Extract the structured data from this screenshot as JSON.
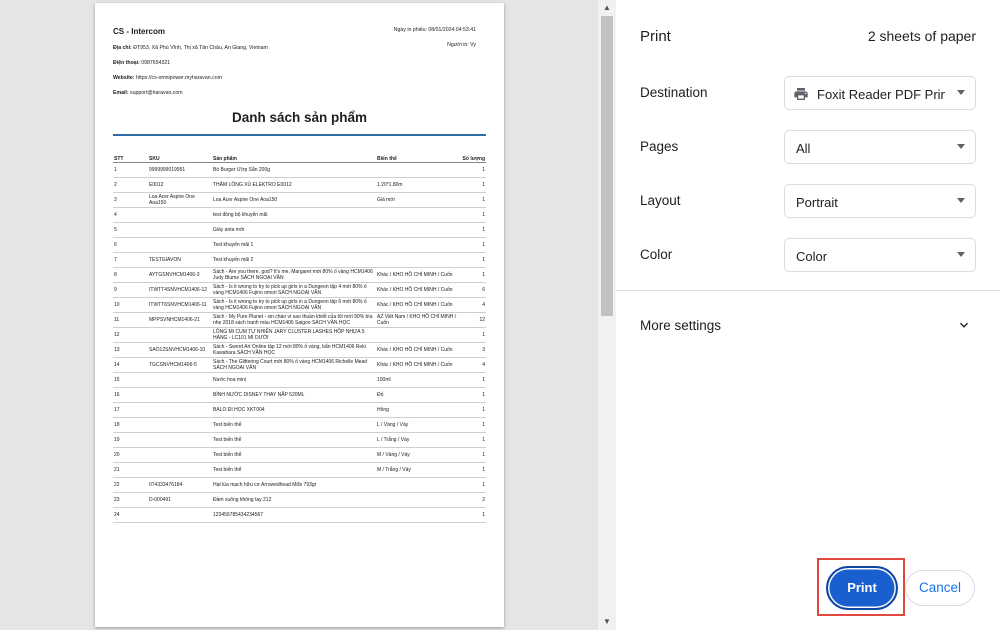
{
  "document": {
    "store_name": "CS - Intercom",
    "address_label": "Địa chỉ:",
    "address": "ĐT953, Xã Phú Vĩnh, Thị xã Tân Châu, An Giang, Vietnam",
    "phone_label": "Điện thoại:",
    "phone": "0987654321",
    "website_label": "Website:",
    "website": "https://cs-omnipower.myharavan.com",
    "email_label": "Email:",
    "email": "support@haravan.com",
    "print_date": "Ngày in phiếu: 08/01/2024 04:53:41",
    "printed_by": "Người in: Vy",
    "heading": "Danh sách sản phẩm",
    "columns": {
      "stt": "STT",
      "sku": "SKU",
      "product": "Sản phẩm",
      "variant": "Biến thể",
      "qty": "Số lượng"
    },
    "rows": [
      {
        "stt": "1",
        "sku": "9999999019951",
        "product": "Bò Burger Ướp Sẵn 200g",
        "variant": "",
        "qty": "1"
      },
      {
        "stt": "2",
        "sku": "E0012",
        "product": "THẢM LÔNG XÙ ELEKTRO E0012",
        "variant": "1.20*1.80m",
        "qty": "1"
      },
      {
        "stt": "3",
        "sku": "Loa Acer Aspire One Aoa150",
        "product": "Loa Acer Aspire One Aoa150",
        "variant": "Giá mới",
        "qty": "1"
      },
      {
        "stt": "4",
        "sku": "",
        "product": "test đồng bộ khuyến mãi",
        "variant": "",
        "qty": "1"
      },
      {
        "stt": "5",
        "sku": "",
        "product": "Giày anta mới",
        "variant": "",
        "qty": "1"
      },
      {
        "stt": "6",
        "sku": "",
        "product": "Test khuyến mãi 1",
        "variant": "",
        "qty": "1"
      },
      {
        "stt": "7",
        "sku": "TESTGIAVON",
        "product": "Test khuyến mãi 2",
        "variant": "",
        "qty": "1"
      },
      {
        "stt": "8",
        "sku": "AYTGSNVHCM1406-3",
        "product": "Sách - Are you there, god? It's me, Margaret mới 80% ố vàng HCM1406 Judy Blume SÁCH NGOẠI VĂN",
        "variant": "Khác / KHO HỒ CHÍ MINH / Cuốn",
        "qty": "1"
      },
      {
        "stt": "9",
        "sku": "ITWTT4SNVHCM1406-12",
        "product": "Sách - Is it wrong to try to pick up girls in a Dungeon tập 4 mới 80% ố vàng HCM1406 Fujino omori SÁCH NGOẠI VĂN",
        "variant": "Khác / KHO HỒ CHÍ MINH / Cuốn",
        "qty": "6"
      },
      {
        "stt": "10",
        "sku": "ITWTT6SNVHCM1406-11",
        "product": "Sách - Is it wrong to try to pick up girls in a Dungeon tập 6 mới 80% ố vàng HCM1406 Fujino omori SÁCH NGOẠI VĂN",
        "variant": "Khác / KHO HỒ CHÍ MINH / Cuốn",
        "qty": "4"
      },
      {
        "stt": "11",
        "sku": "MPPSVNHCM1406-21",
        "product": "Sách - My Pure Planet - xin chào vì sao thuần khiết của tôi mới 90% bìa nhẹ 2018 sách tranh màu HCM1406 Saigoo SÁCH VĂN HỌC",
        "variant": "AZ Việt Nam / KHO HỒ CHÍ MINH / Cuốn",
        "qty": "12"
      },
      {
        "stt": "12",
        "sku": "",
        "product": "LÔNG MI CUM TỰ NHIÊN JARY CLUSTER LASHES HỘP NHỰA 5 HÀNG - LC101 MI DƯỚI",
        "variant": "",
        "qty": "1"
      },
      {
        "stt": "13",
        "sku": "SAO12SNVHCM1406-10",
        "product": "Sách - Sword Art Online tập 12 mới 80% ố vàng, bẩn HCM1406 Reki Kawahara SÁCH VĂN HỌC",
        "variant": "Khác / KHO HỒ CHÍ MINH / Cuốn",
        "qty": "3"
      },
      {
        "stt": "14",
        "sku": "TGCSNVHCM1406-5",
        "product": "Sách - The Glittering Court mới 80% ố vàng HCM1406 Richelle Mead SÁCH NGOẠI VĂN",
        "variant": "Khác / KHO HỒ CHÍ MINH / Cuốn",
        "qty": "4"
      },
      {
        "stt": "15",
        "sku": "",
        "product": "Nước hoa mini",
        "variant": "100ml",
        "qty": "1"
      },
      {
        "stt": "16",
        "sku": "",
        "product": "BÌNH NƯỚC DISNEY THAY NẮP 520ML",
        "variant": "Đỏ",
        "qty": "1"
      },
      {
        "stt": "17",
        "sku": "",
        "product": "BALO ĐI HỌC XKT004",
        "variant": "Hồng",
        "qty": "1"
      },
      {
        "stt": "18",
        "sku": "",
        "product": "Test biến thể",
        "variant": "L / Vàng / Váy",
        "qty": "1"
      },
      {
        "stt": "19",
        "sku": "",
        "product": "Test biến thể",
        "variant": "L / Trắng / Váy",
        "qty": "1"
      },
      {
        "stt": "20",
        "sku": "",
        "product": "Test biến thể",
        "variant": "M / Vàng / Váy",
        "qty": "1"
      },
      {
        "stt": "21",
        "sku": "",
        "product": "Test biến thể",
        "variant": "M / Trắng / Váy",
        "qty": "1"
      },
      {
        "stt": "22",
        "sku": "074333476184",
        "product": "Hạt lúa mạch hữu cơ Arrowedhead Mills 793gr",
        "variant": "",
        "qty": "1"
      },
      {
        "stt": "23",
        "sku": "D-000491",
        "product": "Đầm suông không tay 212",
        "variant": "",
        "qty": "2"
      },
      {
        "stt": "24",
        "sku": "",
        "product": "123456785434234567",
        "variant": "",
        "qty": "1"
      }
    ]
  },
  "settings": {
    "title": "Print",
    "sheets": "2 sheets of paper",
    "destination_label": "Destination",
    "destination_value": "Foxit Reader PDF Printer",
    "pages_label": "Pages",
    "pages_value": "All",
    "layout_label": "Layout",
    "layout_value": "Portrait",
    "color_label": "Color",
    "color_value": "Color",
    "more_settings": "More settings",
    "print_button": "Print",
    "cancel_button": "Cancel"
  },
  "colors": {
    "accent": "#1a73e8",
    "print_button": "#1a5fd0",
    "highlight_outline": "#e2483d",
    "heading_rule": "#2e6da4"
  },
  "icons": {
    "printer": "printer-icon",
    "dropdown": "chevron-down-icon",
    "scroll_up": "scroll-up-arrow-icon",
    "scroll_down": "scroll-down-arrow-icon"
  }
}
